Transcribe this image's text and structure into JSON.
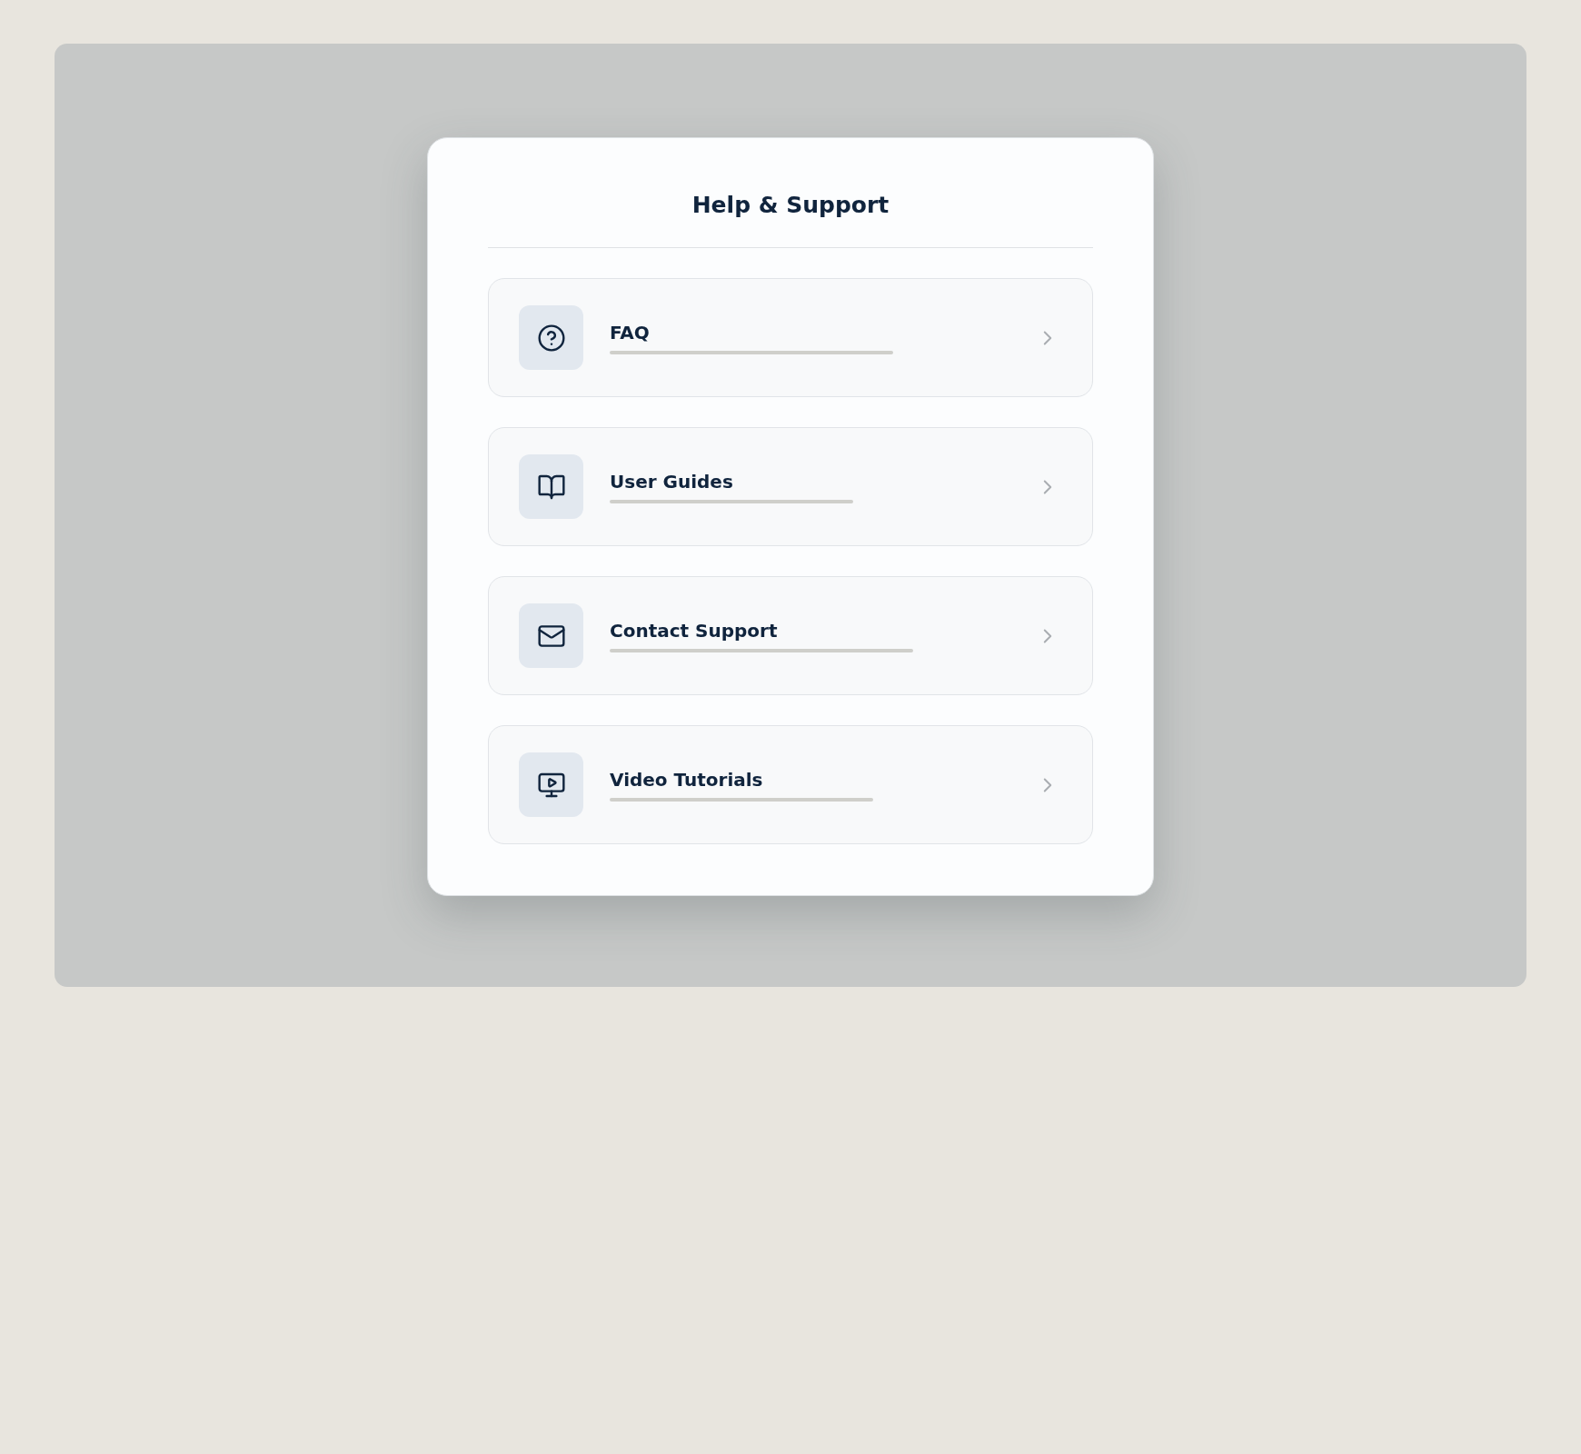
{
  "dialog": {
    "title": "Help & Support"
  },
  "items": [
    {
      "label": "FAQ",
      "kind": "help"
    },
    {
      "label": "User Guides",
      "kind": "book"
    },
    {
      "label": "Contact Support",
      "kind": "mail"
    },
    {
      "label": "Video Tutorials",
      "kind": "video"
    }
  ]
}
